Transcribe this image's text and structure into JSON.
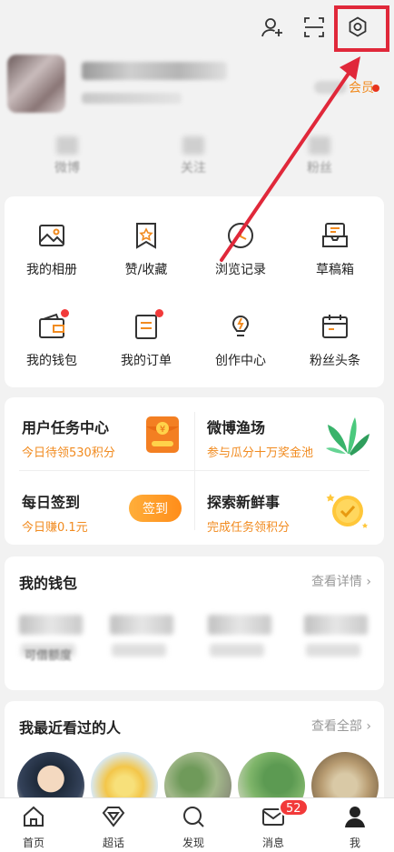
{
  "topbar": {
    "icons": [
      "add-user-icon",
      "scan-icon",
      "settings-icon"
    ]
  },
  "profile": {
    "vip_label": "会员"
  },
  "stats": [
    {
      "label": "微博"
    },
    {
      "label": "关注"
    },
    {
      "label": "粉丝"
    }
  ],
  "grid": [
    {
      "label": "我的相册",
      "icon": "image-icon"
    },
    {
      "label": "赞/收藏",
      "icon": "star-tag-icon"
    },
    {
      "label": "浏览记录",
      "icon": "clock-icon"
    },
    {
      "label": "草稿箱",
      "icon": "inbox-icon"
    },
    {
      "label": "我的钱包",
      "icon": "wallet-icon"
    },
    {
      "label": "我的订单",
      "icon": "order-icon"
    },
    {
      "label": "创作中心",
      "icon": "lightning-icon"
    },
    {
      "label": "粉丝头条",
      "icon": "calendar-icon"
    }
  ],
  "tasks": [
    {
      "title": "用户任务中心",
      "sub": "今日待领530积分"
    },
    {
      "title": "微博渔场",
      "sub": "参与瓜分十万奖金池"
    },
    {
      "title": "每日签到",
      "sub": "今日赚0.1元",
      "button": "签到"
    },
    {
      "title": "探索新鲜事",
      "sub": "完成任务领积分"
    }
  ],
  "wallet": {
    "title": "我的钱包",
    "more": "查看详情 ›",
    "item_label": "可借额度"
  },
  "recent": {
    "title": "我最近看过的人",
    "more": "查看全部 ›"
  },
  "tabbar": [
    {
      "label": "首页"
    },
    {
      "label": "超话"
    },
    {
      "label": "发现"
    },
    {
      "label": "消息",
      "badge": "52"
    },
    {
      "label": "我"
    }
  ],
  "colors": {
    "accent": "#f18b20",
    "highlight": "#e0283a",
    "badge": "#f23a3a"
  }
}
